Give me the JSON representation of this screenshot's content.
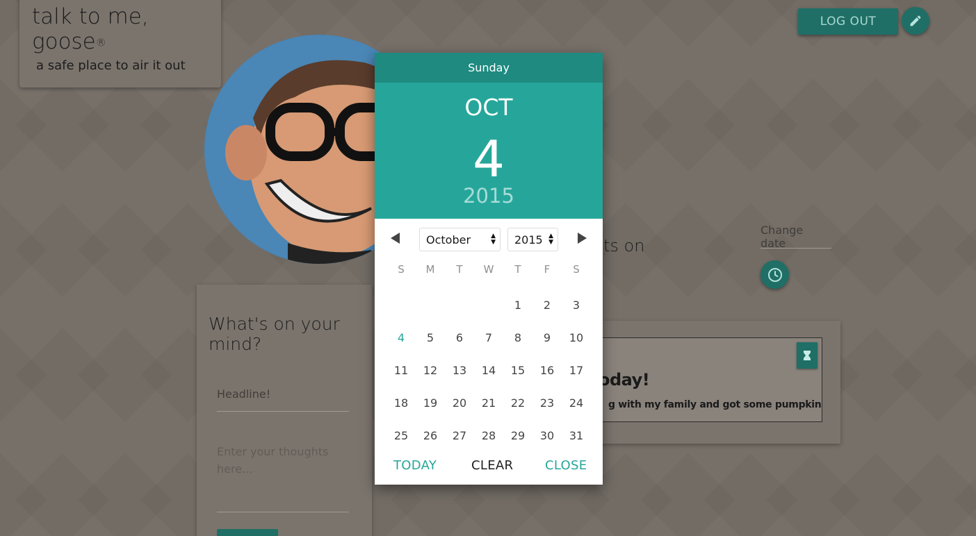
{
  "app": {
    "title": "talk to me, goose",
    "registered": "®",
    "tagline": "a safe place to air it out"
  },
  "header": {
    "logout_label": "LOG OUT",
    "edit_icon": "pencil-icon"
  },
  "feed": {
    "heading_fragment": "ts on",
    "change_date_placeholder": "Change date",
    "clock_icon": "clock-icon"
  },
  "compose": {
    "title": "What's on your mind?",
    "headline_placeholder": "Headline!",
    "thoughts_placeholder": "Enter your thoughts here..."
  },
  "post": {
    "title_fragment": "oday!",
    "body_fragment": "g with my family and got some pumpkins!",
    "bookmark_icon": "bookmark-icon"
  },
  "datepicker": {
    "weekday": "Sunday",
    "month_short": "OCT",
    "day": "4",
    "year": "2015",
    "month_select": "October",
    "year_select": "2015",
    "weekday_headers": [
      "S",
      "M",
      "T",
      "W",
      "T",
      "F",
      "S"
    ],
    "weeks": [
      [
        "",
        "",
        "",
        "",
        "1",
        "2",
        "3"
      ],
      [
        "4",
        "5",
        "6",
        "7",
        "8",
        "9",
        "10"
      ],
      [
        "11",
        "12",
        "13",
        "14",
        "15",
        "16",
        "17"
      ],
      [
        "18",
        "19",
        "20",
        "21",
        "22",
        "23",
        "24"
      ],
      [
        "25",
        "26",
        "27",
        "28",
        "29",
        "30",
        "31"
      ]
    ],
    "selected_day": "4",
    "today_label": "TODAY",
    "clear_label": "CLEAR",
    "close_label": "CLOSE"
  },
  "colors": {
    "accent": "#26a69a",
    "accent_dark": "#1e8a80",
    "background": "#777069"
  }
}
